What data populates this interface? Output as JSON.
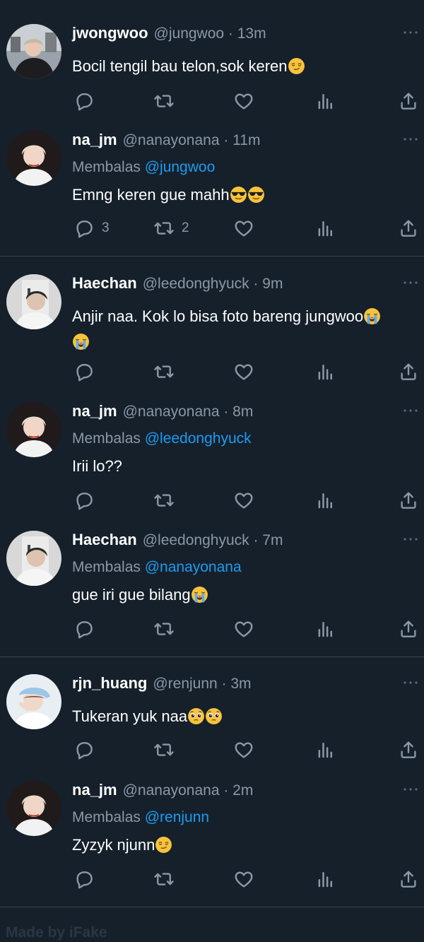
{
  "colors": {
    "background": "#15202b",
    "name": "#ffffff",
    "muted": "#8b98a5",
    "mention": "#1d9bf0",
    "divider": "#38444d"
  },
  "reply_prefix": "Membalas",
  "tweets": [
    {
      "name": "jwongwoo",
      "meta": "@jungwoo · 13m",
      "reply_to": "",
      "text": "Bocil tengil bau telon,sok keren",
      "emoji": [
        "smirk-emoji"
      ],
      "reply_count": "",
      "retweet_count": ""
    },
    {
      "name": "na_jm",
      "meta": "@nanayonana · 11m",
      "reply_to": "@jungwoo",
      "text": "Emng keren gue mahh",
      "emoji": [
        "sunglasses-emoji",
        "sunglasses-emoji"
      ],
      "reply_count": "3",
      "retweet_count": "2"
    },
    {
      "name": "Haechan",
      "meta": "@leedonghyuck · 9m",
      "reply_to": "",
      "text": "Anjir naa. Kok lo bisa foto bareng jungwoo",
      "emoji": [
        "loudly-crying-emoji",
        "loudly-crying-emoji"
      ],
      "reply_count": "",
      "retweet_count": ""
    },
    {
      "name": "na_jm",
      "meta": "@nanayonana · 8m",
      "reply_to": "@leedonghyuck",
      "text": "Irii lo??",
      "emoji": [],
      "reply_count": "",
      "retweet_count": ""
    },
    {
      "name": "Haechan",
      "meta": "@leedonghyuck · 7m",
      "reply_to": "@nanayonana",
      "text": "gue iri gue bilang",
      "emoji": [
        "loudly-crying-emoji"
      ],
      "reply_count": "",
      "retweet_count": ""
    },
    {
      "name": "rjn_huang",
      "meta": "@renjunn · 3m",
      "reply_to": "",
      "text": "Tukeran yuk naa",
      "emoji": [
        "pleading-emoji",
        "pleading-emoji"
      ],
      "reply_count": "",
      "retweet_count": ""
    },
    {
      "name": "na_jm",
      "meta": "@nanayonana · 2m",
      "reply_to": "@renjunn",
      "text": "Zyzyk njunn",
      "emoji": [
        "smirk-emoji"
      ],
      "reply_count": "",
      "retweet_count": ""
    }
  ],
  "icons": [
    "reply-icon",
    "retweet-icon",
    "like-icon",
    "analytics-icon",
    "share-icon",
    "more-icon"
  ],
  "watermark": "Made by iFake"
}
